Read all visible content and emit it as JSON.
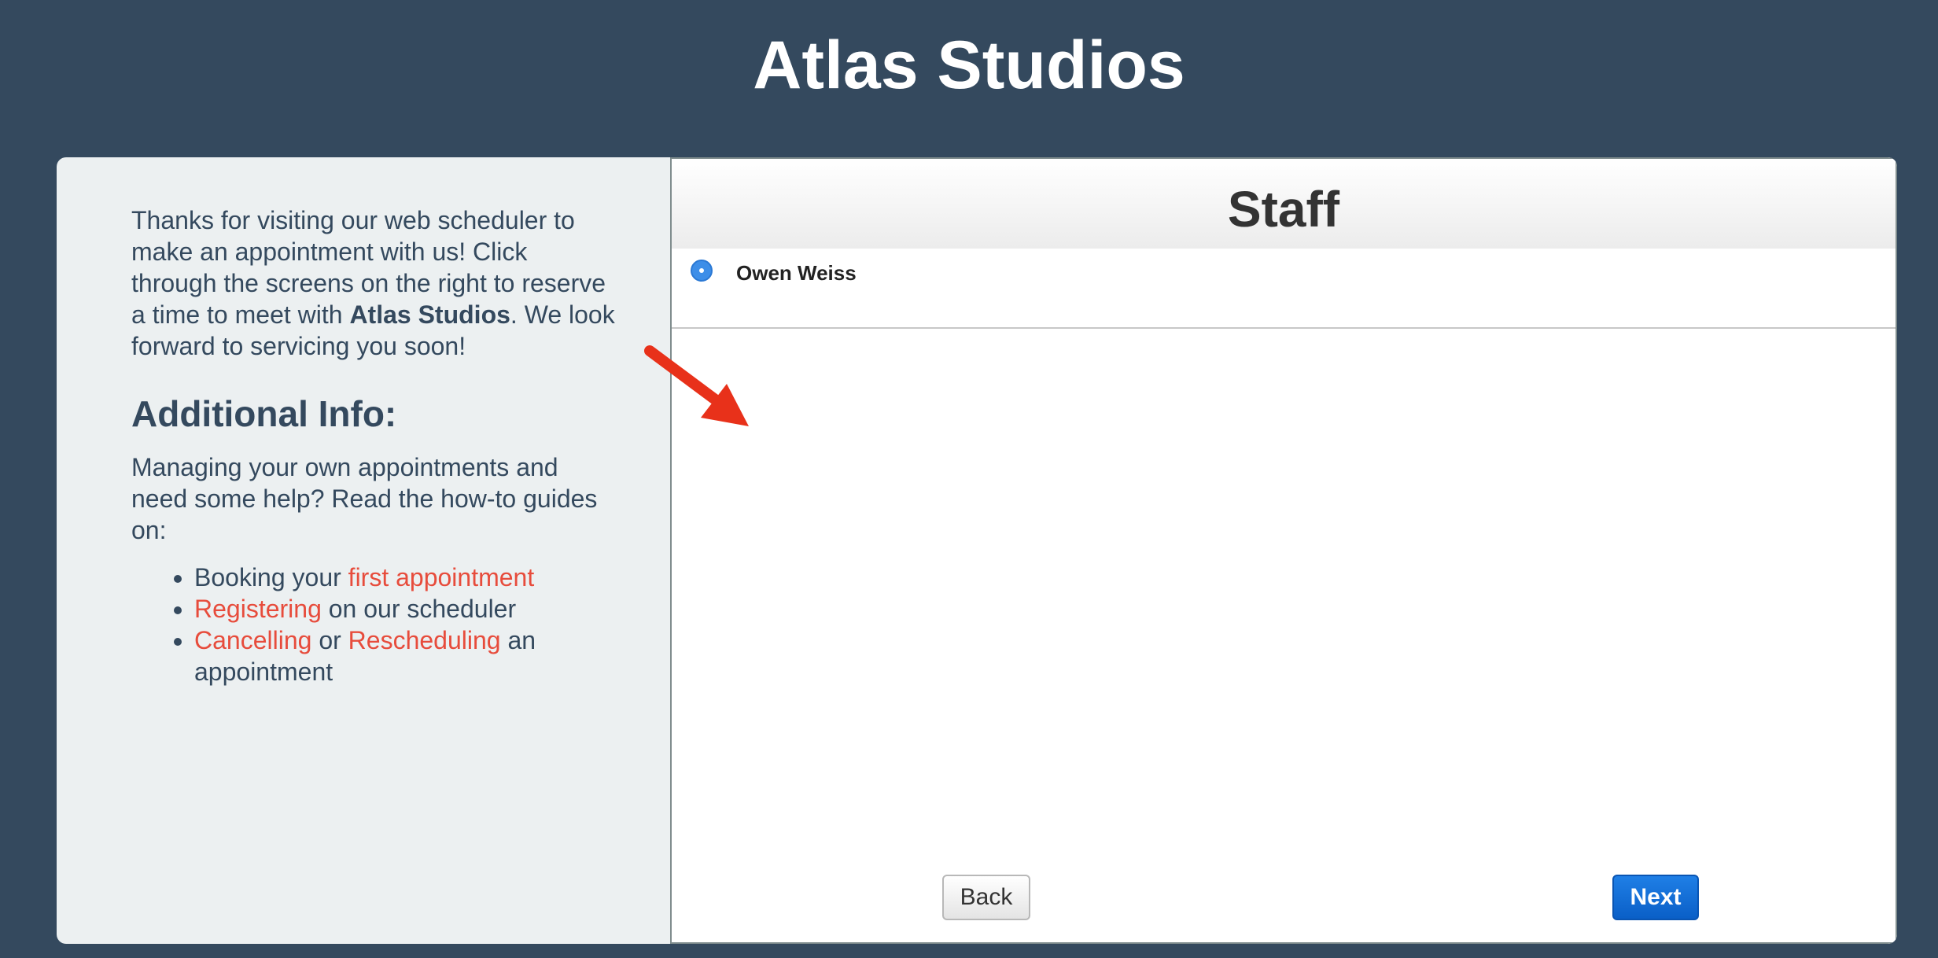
{
  "header": {
    "title": "Atlas Studios"
  },
  "sidebar": {
    "intro_before": "Thanks for visiting our web scheduler to make an appointment with us! Click through the screens on the right to reserve a time to meet with ",
    "intro_company": "Atlas Studios",
    "intro_after": ". We look forward to servicing you soon!",
    "info_heading": "Additional Info:",
    "help_text": "Managing your own appointments and need some help? Read the how-to guides on:",
    "guides": [
      {
        "prefix": "Booking your ",
        "link": "first appointment",
        "suffix": ""
      },
      {
        "prefix": "",
        "link": "Registering",
        "suffix": " on our scheduler"
      },
      {
        "prefix": "",
        "link": "Cancelling",
        "middle": " or ",
        "link2": "Rescheduling",
        "suffix": " an appointment"
      }
    ]
  },
  "panel": {
    "title": "Staff",
    "staff": [
      {
        "name": "Owen Weiss",
        "selected": true
      }
    ],
    "back_label": "Back",
    "next_label": "Next"
  },
  "colors": {
    "background": "#34495e",
    "link": "#e74c3c",
    "primary_button": "#0a5fc7",
    "arrow": "#e8311a"
  }
}
